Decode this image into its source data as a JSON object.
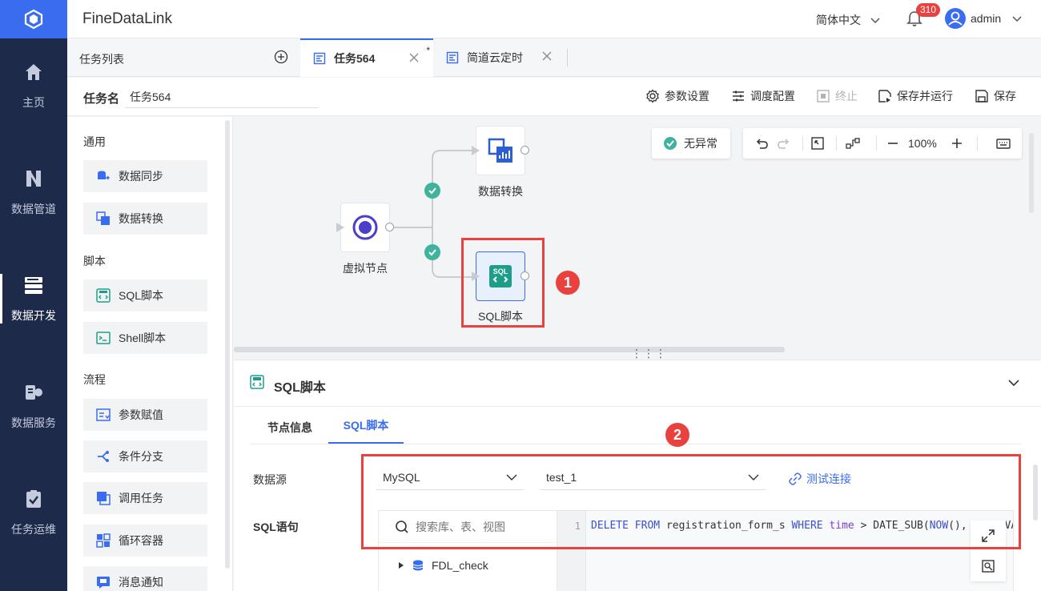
{
  "app": {
    "title": "FineDataLink"
  },
  "topbar": {
    "language": "简体中文",
    "notifications": "310",
    "user": "admin"
  },
  "nav": {
    "items": [
      {
        "label": "主页"
      },
      {
        "label": "数据管道"
      },
      {
        "label": "数据开发"
      },
      {
        "label": "数据服务"
      },
      {
        "label": "任务运维"
      }
    ],
    "active": "数据开发"
  },
  "tabbar": {
    "list_label": "任务列表",
    "tabs": [
      {
        "label": "任务564",
        "modified": "*"
      },
      {
        "label": "简道云定时"
      }
    ]
  },
  "taskbar": {
    "name_label": "任务名",
    "name_value": "任务564",
    "actions": {
      "params": "参数设置",
      "schedule": "调度配置",
      "stop": "终止",
      "save_run": "保存并运行",
      "save": "保存"
    }
  },
  "palette": {
    "groups": [
      {
        "title": "通用",
        "items": [
          "数据同步",
          "数据转换"
        ]
      },
      {
        "title": "脚本",
        "items": [
          "SQL脚本",
          "Shell脚本"
        ]
      },
      {
        "title": "流程",
        "items": [
          "参数赋值",
          "条件分支",
          "调用任务",
          "循环容器",
          "消息通知"
        ]
      }
    ]
  },
  "canvas": {
    "status": "无异常",
    "zoom": "100%",
    "nodes": {
      "virtual": "虚拟节点",
      "transform": "数据转换",
      "sql": "SQL脚本"
    },
    "callouts": [
      "1",
      "2"
    ]
  },
  "panel": {
    "title": "SQL脚本",
    "tabs": {
      "node_info": "节点信息",
      "sql": "SQL脚本"
    },
    "datasource_label": "数据源",
    "datasource_type": "MySQL",
    "database": "test_1",
    "test_connection": "测试连接",
    "sql_label": "SQL语句",
    "search_placeholder": "搜索库、表、视图",
    "tree_item": "FDL_check",
    "editor": {
      "line_number": "1",
      "code": {
        "kw1": "DELETE",
        "kw2": "FROM",
        "table": "registration_form_s",
        "kw3": "WHERE",
        "field": "time",
        "op": ">",
        "fn1": "DATE_SUB(",
        "fn2": "NOW",
        "rest": "(), INTERVAL"
      }
    }
  },
  "colors": {
    "nav_bg": "#1d2a4a",
    "accent": "#3a6cf0",
    "highlight": "#e8413e",
    "success": "#3fb39b"
  }
}
